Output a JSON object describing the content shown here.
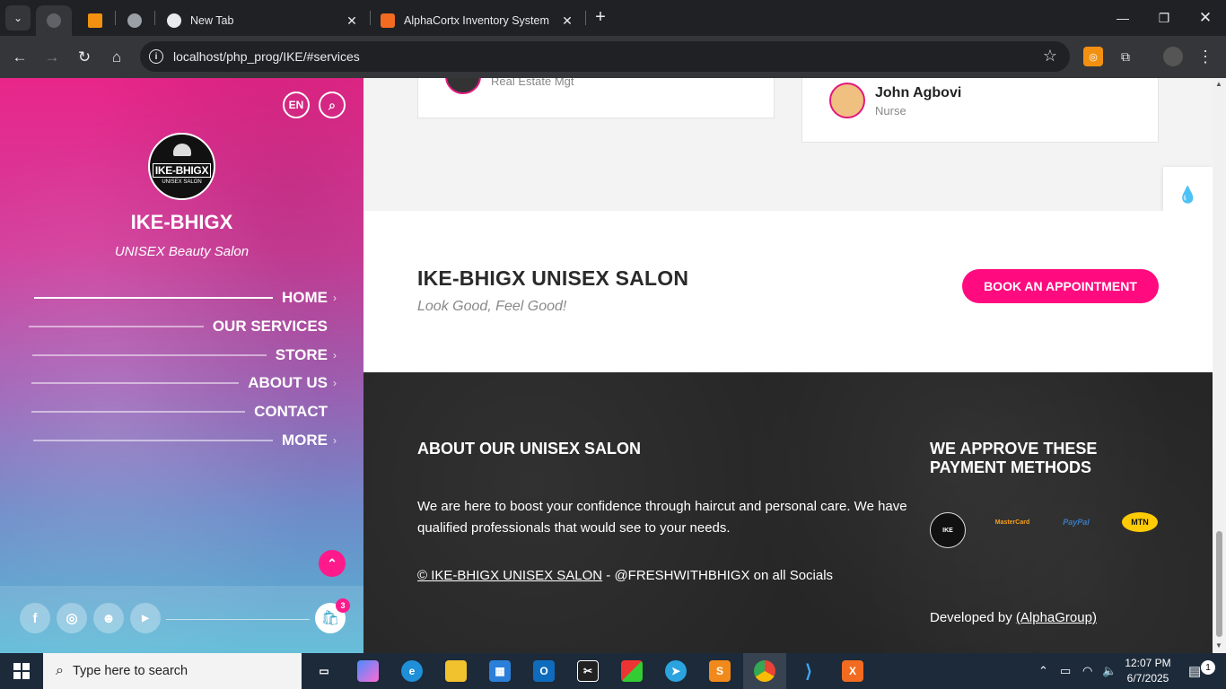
{
  "browser": {
    "tabs": [
      {
        "title": "",
        "active": true
      },
      {
        "title": "",
        "active": false
      },
      {
        "title": "",
        "active": false
      },
      {
        "title": "New Tab",
        "active": false
      },
      {
        "title": "AlphaCortx Inventory System",
        "active": false
      }
    ],
    "url": "localhost/php_prog/IKE/#services"
  },
  "sidebar": {
    "lang_label": "EN",
    "logo_text": "IKE-BHIGX",
    "logo_sub": "UNISEX SALON",
    "title": "IKE-BHIGX",
    "tagline": "UNISEX Beauty Salon",
    "nav": [
      {
        "label": "HOME",
        "chevron": true
      },
      {
        "label": "OUR SERVICES",
        "chevron": false
      },
      {
        "label": "STORE",
        "chevron": true
      },
      {
        "label": "ABOUT US",
        "chevron": true
      },
      {
        "label": "CONTACT",
        "chevron": false
      },
      {
        "label": "MORE",
        "chevron": true
      }
    ],
    "cart_count": "3"
  },
  "testimonials": [
    {
      "name": "",
      "role": "Real Estate Mgt"
    },
    {
      "name": "John Agbovi",
      "role": "Nurse"
    }
  ],
  "cta": {
    "title": "IKE-BHIGX UNISEX SALON",
    "subtitle": "Look Good, Feel Good!",
    "button": "BOOK AN APPOINTMENT"
  },
  "footer": {
    "about_heading": "ABOUT OUR UNISEX SALON",
    "about_text": "We are here to boost your confidence through haircut and personal care. We have qualified professionals that would see to your needs.",
    "copyright_link": "© IKE-BHIGX UNISEX SALON",
    "copyright_rest": " - @FRESHWITHBHIGX on all Socials",
    "payment_heading": "WE APPROVE THESE PAYMENT METHODS",
    "payment_methods": [
      "MasterCard",
      "PayPal",
      "MTN"
    ],
    "developed_by": "Developed by ",
    "developer_link": "(AlphaGroup)"
  },
  "taskbar": {
    "search_placeholder": "Type here to search",
    "time": "12:07 PM",
    "date": "6/7/2025",
    "notification_count": "1"
  },
  "colors": {
    "brand_pink": "#ff0a7f",
    "footer_bg": "#262626",
    "chrome_dark": "#202124"
  }
}
